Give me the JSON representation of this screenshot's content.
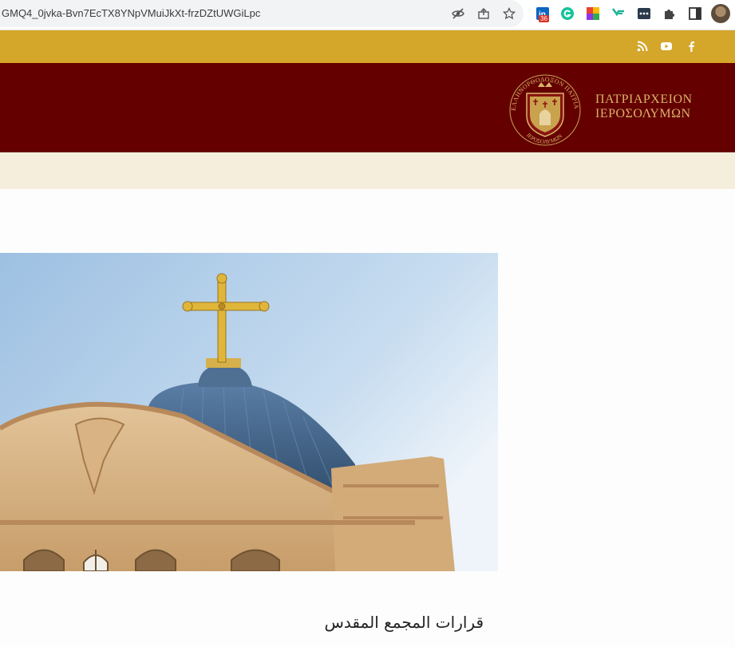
{
  "browser": {
    "url": "GMQ4_0jvka-Bvn7EcTX8YNpVMuiJkXt-frzDZtUWGiLpc",
    "extension_badge": "36",
    "toolbar_icons": [
      "eye-off-icon",
      "share-icon",
      "star-icon",
      "linkedin-extension-icon",
      "grammarly-icon",
      "colorful-grid-extension-icon",
      "vf-extension-icon",
      "dots-extension-icon",
      "puzzle-icon",
      "sidepanel-icon",
      "profile-avatar"
    ]
  },
  "social": {
    "icons": [
      "rss-icon",
      "youtube-icon",
      "facebook-icon"
    ]
  },
  "header": {
    "logo_line1": "ΠΑΤΡΙΑΡΧΕΙΟΝ",
    "logo_line2": "ΙΕΡΟΣΟΛΥΜΩΝ",
    "seal_top_text": "ΕΛΛΗΝΟΡΘΟΔΟΞΟΝ ΠΑΤΡΙΑΡΧΕΙΟΝ",
    "seal_bottom_text": "ΙΕΡΟΣΟΛΥΜΩΝ"
  },
  "main": {
    "title": "قرارات المجمع المقدس"
  },
  "colors": {
    "gold_bar": "#d4a62a",
    "header_maroon": "#640000",
    "nav_cream": "#f5eedc",
    "logo_gold": "#d9b36a"
  }
}
